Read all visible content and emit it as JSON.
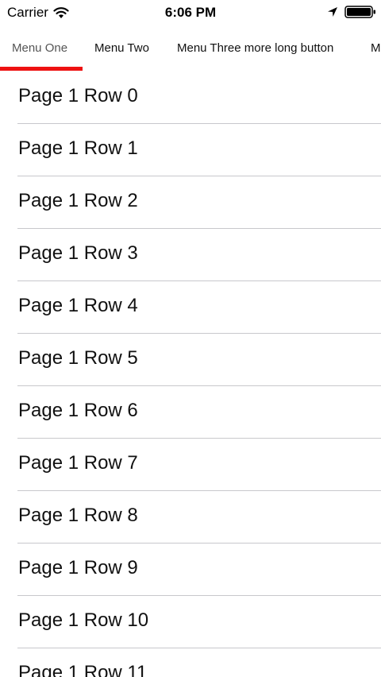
{
  "status_bar": {
    "carrier": "Carrier",
    "time": "6:06 PM"
  },
  "menu": {
    "items": [
      {
        "label": "Menu One"
      },
      {
        "label": "Menu Two"
      },
      {
        "label": "Menu Three more long button"
      },
      {
        "label": "M"
      }
    ],
    "active_index": 0,
    "indicator_color": "#ee1111"
  },
  "list": {
    "rows": [
      {
        "label": "Page 1 Row 0"
      },
      {
        "label": "Page 1 Row 1"
      },
      {
        "label": "Page 1 Row 2"
      },
      {
        "label": "Page 1 Row 3"
      },
      {
        "label": "Page 1 Row 4"
      },
      {
        "label": "Page 1 Row 5"
      },
      {
        "label": "Page 1 Row 6"
      },
      {
        "label": "Page 1 Row 7"
      },
      {
        "label": "Page 1 Row 8"
      },
      {
        "label": "Page 1 Row 9"
      },
      {
        "label": "Page 1 Row 10"
      },
      {
        "label": "Page 1 Row 11"
      }
    ]
  }
}
